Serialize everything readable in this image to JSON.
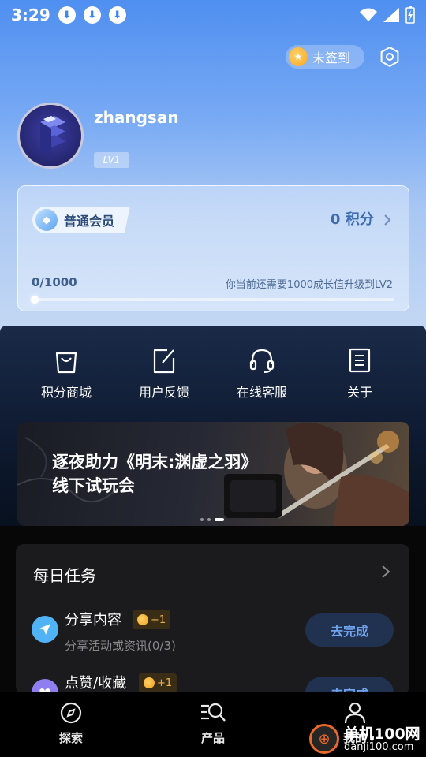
{
  "status_bar": {
    "time": "3:29",
    "download_icons": [
      "download-icon",
      "download-icon",
      "download-icon"
    ],
    "right_icons": [
      "wifi-icon",
      "signal-icon",
      "battery-charging-icon"
    ]
  },
  "header": {
    "signin_label": "未签到",
    "settings_icon": "settings-hexagon-icon"
  },
  "profile": {
    "username": "zhangsan",
    "level": "LV1"
  },
  "membership": {
    "tier": "普通会员",
    "points": "0 积分",
    "progress_text": "0/1000",
    "progress_value": 0,
    "progress_max": 1000,
    "hint": "你当前还需要1000成长值升级到LV2"
  },
  "quick_actions": [
    {
      "label": "积分商城",
      "icon": "shopping-bag-icon"
    },
    {
      "label": "用户反馈",
      "icon": "edit-icon"
    },
    {
      "label": "在线客服",
      "icon": "headset-icon"
    },
    {
      "label": "关于",
      "icon": "document-icon"
    }
  ],
  "banner": {
    "line1": "逐夜助力《明末:渊虚之羽》",
    "line2": "线下试玩会",
    "dot_count": 3,
    "active_dot": 2
  },
  "daily_tasks": {
    "title": "每日任务",
    "tasks": [
      {
        "title": "分享内容",
        "reward": "+1",
        "desc": "分享活动或资讯(0/3)",
        "button": "去完成",
        "icon": "paper-plane-icon",
        "icon_color": "#4fb3f6"
      },
      {
        "title": "点赞/收藏",
        "reward": "+1",
        "desc": "",
        "button": "去完成",
        "icon": "heart-icon",
        "icon_color": "#8f7df2"
      }
    ]
  },
  "tab_bar": [
    {
      "label": "探索",
      "icon": "compass-icon"
    },
    {
      "label": "产品",
      "icon": "search-list-icon"
    },
    {
      "label": "我的",
      "icon": "user-icon"
    }
  ],
  "watermark": {
    "line1": "单机100网",
    "line2": "danji100.com"
  },
  "colors": {
    "accent": "#3a86ef",
    "button_text": "#6fa3ee",
    "reward": "#e8b24a"
  }
}
